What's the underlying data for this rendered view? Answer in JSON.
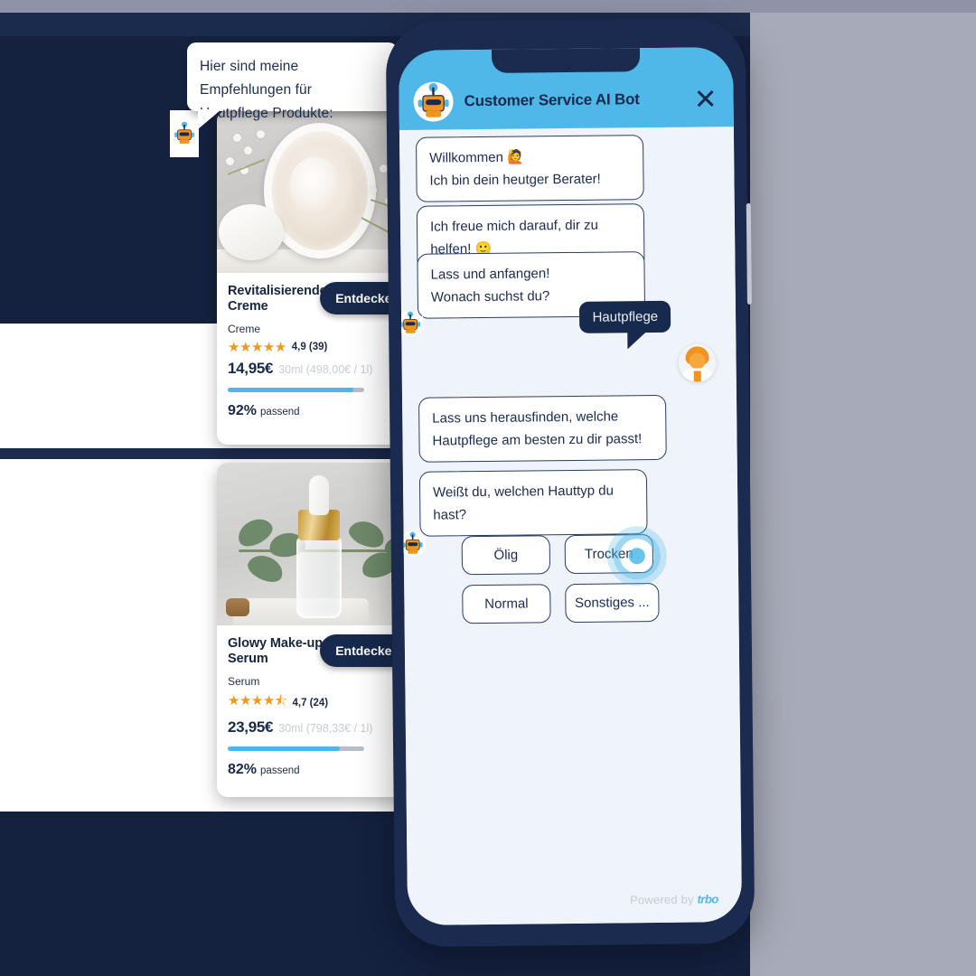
{
  "background": {
    "promo_bubble": "Hier sind meine Empfehlungen für Hautpflege Produkte:",
    "navy": "#14213f",
    "accent_blue": "#4fb8e8",
    "star_orange": "#f0971f"
  },
  "products": [
    {
      "name": "Revitalisierende Creme",
      "category": "Creme",
      "stars": "★★★★★",
      "rating": "4,9 (39)",
      "price": "14,95€",
      "unit": "30ml (498,00€ / 1l)",
      "match_pct": "92%",
      "match_label": "passend",
      "match_value": 92,
      "button": "Entdecken",
      "info_icon": "info-icon",
      "cart_icon": "shopping-cart-icon"
    },
    {
      "name": "Glowy Make-up Serum",
      "category": "Serum",
      "stars": "★★★★⯪",
      "rating": "4,7 (24)",
      "price": "23,95€",
      "unit": "30ml (798,33€ / 1l)",
      "match_pct": "82%",
      "match_label": "passend",
      "match_value": 82,
      "button": "Entdecken",
      "info_icon": "info-icon",
      "cart_icon": "shopping-cart-icon"
    }
  ],
  "phone": {
    "header": {
      "title": "Customer Service AI Bot",
      "avatar_icon": "robot-avatar-icon",
      "close_icon": "✕"
    },
    "messages": [
      {
        "from": "bot",
        "line1": "Willkommen 🙋",
        "line2": "Ich bin dein heutger Berater!"
      },
      {
        "from": "bot",
        "line1": "Ich freue mich darauf, dir zu helfen! 🙂",
        "line2": ""
      },
      {
        "from": "bot",
        "line1": "Lass und anfangen!",
        "line2": "Wonach suchst du?"
      },
      {
        "from": "user",
        "line1": "Hautpflege",
        "line2": ""
      },
      {
        "from": "bot",
        "line1": "Lass uns herausfinden, welche",
        "line2": "Hautpflege am besten zu dir passt!"
      },
      {
        "from": "bot",
        "line1": "Weißt du, welchen Hauttyp du",
        "line2": "hast?"
      }
    ],
    "options": [
      "Ölig",
      "Trocken",
      "Normal",
      "Sonstiges ..."
    ],
    "active_option": "Trocken",
    "footer_prefix": "Powered by ",
    "footer_brand": "trbo"
  }
}
